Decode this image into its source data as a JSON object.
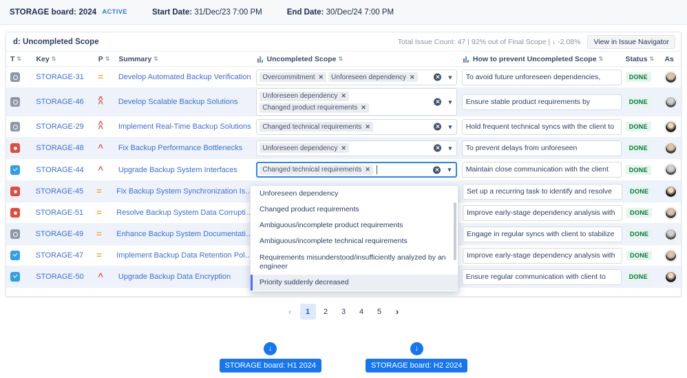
{
  "topbar": {
    "board_title": "STORAGE board: 2024",
    "active_label": "ACTIVE",
    "start_label": "Start Date:",
    "start_value": "31/Dec/23 7:00 PM",
    "end_label": "End Date:",
    "end_value": "30/Dec/24 7:00 PM"
  },
  "card": {
    "title": "d: Uncompleted Scope",
    "stats": "Total Issue Count: 47 | 92% out of Final Scope | ↓ -2.08%",
    "view_button": "View in Issue Navigator"
  },
  "columns": {
    "type": "T",
    "key": "Key",
    "priority": "P",
    "summary": "Summary",
    "scope": "Uncompleted Scope",
    "prevent": "How to prevent Uncompleted Scope",
    "status": "Status",
    "assignee": "As"
  },
  "rows": [
    {
      "type_icon": "task-icon",
      "key": "STORAGE-31",
      "priority_icon": "priority-medium-icon",
      "summary": "Develop Automated Backup Verification",
      "scope_tags": [
        "Overcommitment",
        "Unforeseen dependency"
      ],
      "prevent": "To avoid future unforeseen dependencies,",
      "status": "DONE"
    },
    {
      "type_icon": "task-icon",
      "key": "STORAGE-46",
      "priority_icon": "priority-highest-icon",
      "summary": "Develop Scalable Backup Solutions",
      "scope_tags": [
        "Unforeseen dependency",
        "Changed product requirements"
      ],
      "prevent": "Ensure stable product requirements by",
      "status": "DONE"
    },
    {
      "type_icon": "task-icon",
      "key": "STORAGE-29",
      "priority_icon": "priority-highest-icon",
      "summary": "Implement Real-Time Backup Solutions",
      "scope_tags": [
        "Changed technical requirements"
      ],
      "prevent": "Hold frequent technical syncs with the client to",
      "status": "DONE"
    },
    {
      "type_icon": "bug-icon",
      "key": "STORAGE-48",
      "priority_icon": "priority-high-icon",
      "summary": "Fix Backup Performance Bottlenecks",
      "scope_tags": [
        "Unforeseen dependency"
      ],
      "prevent": "To prevent delays from unforeseen",
      "status": "DONE"
    },
    {
      "type_icon": "story-icon",
      "key": "STORAGE-44",
      "priority_icon": "priority-high-icon",
      "summary": "Upgrade Backup System Interfaces",
      "scope_tags": [
        "Changed technical requirements"
      ],
      "prevent": "Maintain close communication with the client",
      "status": "DONE"
    },
    {
      "type_icon": "bug-icon",
      "key": "STORAGE-45",
      "priority_icon": "priority-medium-icon",
      "summary": "Fix Backup System Synchronization Issues",
      "scope_tags": [],
      "prevent": "Set up a recurring task to identify and resolve",
      "status": "DONE"
    },
    {
      "type_icon": "bug-icon",
      "key": "STORAGE-51",
      "priority_icon": "priority-medium-icon",
      "summary": "Resolve Backup System Data Corruption",
      "scope_tags": [],
      "prevent": "Improve early-stage dependency analysis with",
      "status": "DONE"
    },
    {
      "type_icon": "task-icon",
      "key": "STORAGE-49",
      "priority_icon": "priority-medium-icon",
      "summary": "Enhance Backup System Documentation",
      "scope_tags": [],
      "prevent": "Engage in regular syncs with client to stabilize",
      "status": "DONE"
    },
    {
      "type_icon": "story-icon",
      "key": "STORAGE-47",
      "priority_icon": "priority-medium-icon",
      "summary": "Implement Backup Data Retention Policies",
      "scope_tags": [],
      "prevent": "Improve early-stage dependency analysis with",
      "status": "DONE"
    },
    {
      "type_icon": "story-icon",
      "key": "STORAGE-50",
      "priority_icon": "priority-high-icon",
      "summary": "Upgrade Backup Data Encryption",
      "scope_tags": [],
      "prevent": "Ensure regular communication with client to",
      "status": "DONE"
    }
  ],
  "dropdown": {
    "options": [
      "Unforeseen dependency",
      "Changed product requirements",
      "Ambiguous/incomplete product requirements",
      "Ambiguous/incomplete technical requirements",
      "Requirements misunderstood/insufficiently analyzed by an engineer",
      "Priority suddenly decreased"
    ],
    "selected": "Priority suddenly decreased"
  },
  "pagination": {
    "prev": "‹",
    "pages": [
      "1",
      "2",
      "3",
      "4",
      "5"
    ],
    "current": "1",
    "next": "›"
  },
  "downloads": [
    {
      "icon": "download-icon",
      "label": "STORAGE board: H1 2024"
    },
    {
      "icon": "download-icon",
      "label": "STORAGE board: H2 2024"
    }
  ],
  "colors": {
    "link": "#3b6fd4",
    "accent": "#1675f0",
    "done_text": "#0a6e3d",
    "done_bg": "#e4f7ec",
    "active_tag": "#2979f2"
  }
}
